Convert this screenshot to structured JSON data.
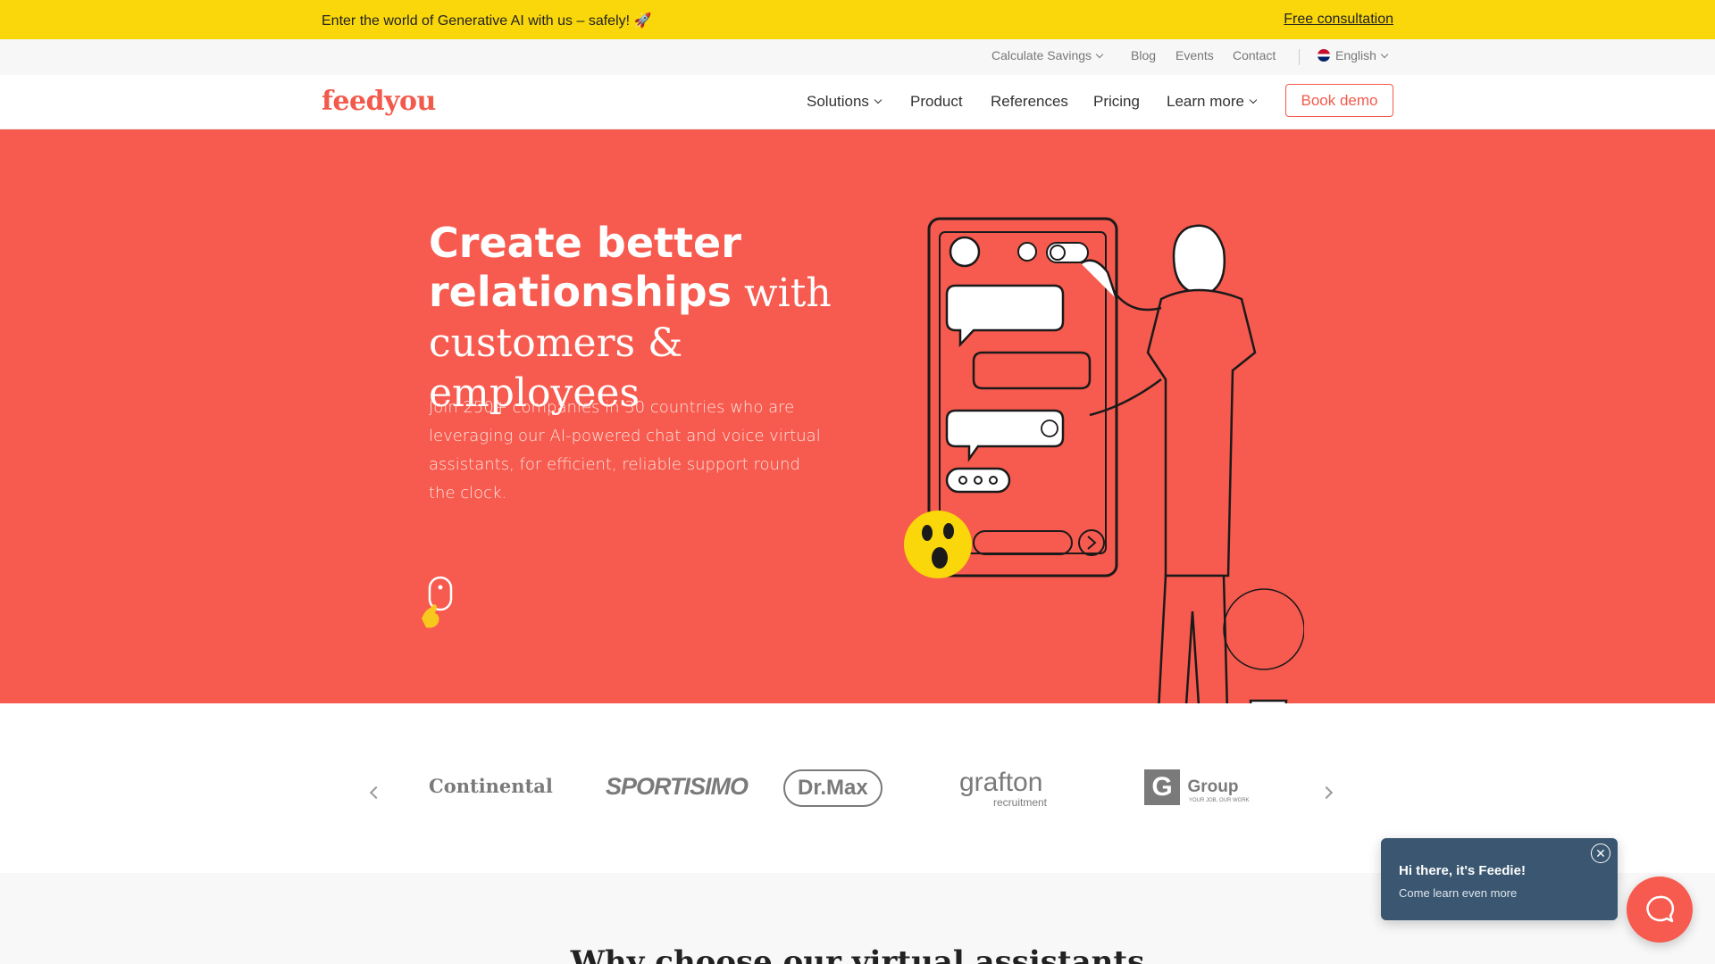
{
  "announcement": {
    "text": "Enter the world of Generative AI with us – safely! 🚀",
    "link": "Free consultation"
  },
  "utility_nav": {
    "calculate_savings": "Calculate Savings",
    "blog": "Blog",
    "events": "Events",
    "contact": "Contact",
    "language": "English"
  },
  "brand": {
    "logo": "feedyou",
    "accent": "#f25a4b"
  },
  "main_nav": {
    "solutions": "Solutions",
    "product": "Product",
    "references": "References",
    "pricing": "Pricing",
    "learn_more": "Learn more",
    "book_demo": "Book demo"
  },
  "hero": {
    "title_bold_1": "Create better",
    "title_bold_2": "relationships",
    "title_serif_1": " with",
    "title_serif_2": "customers & employees",
    "subtitle": "Join 250+ companies in 30 countries who are leveraging our AI-powered chat and voice virtual assistants, for efficient, reliable support round the clock.",
    "background": "#f75a4e"
  },
  "clients": {
    "continental": "Continental",
    "sportisimo": "SPORTISIMO",
    "drmax": "Dr.Max",
    "grafton": "grafton",
    "grafton_sub": "recruitment",
    "group": "Group",
    "group_tagline": "YOUR JOB, OUR WORK"
  },
  "section": {
    "why_title": "Why choose our virtual assistants"
  },
  "chat_widget": {
    "title": "Hi there, it's Feedie!",
    "subtitle": "Come learn even more",
    "close_icon": "close-icon",
    "launcher_icon": "chat-bubble-icon"
  }
}
